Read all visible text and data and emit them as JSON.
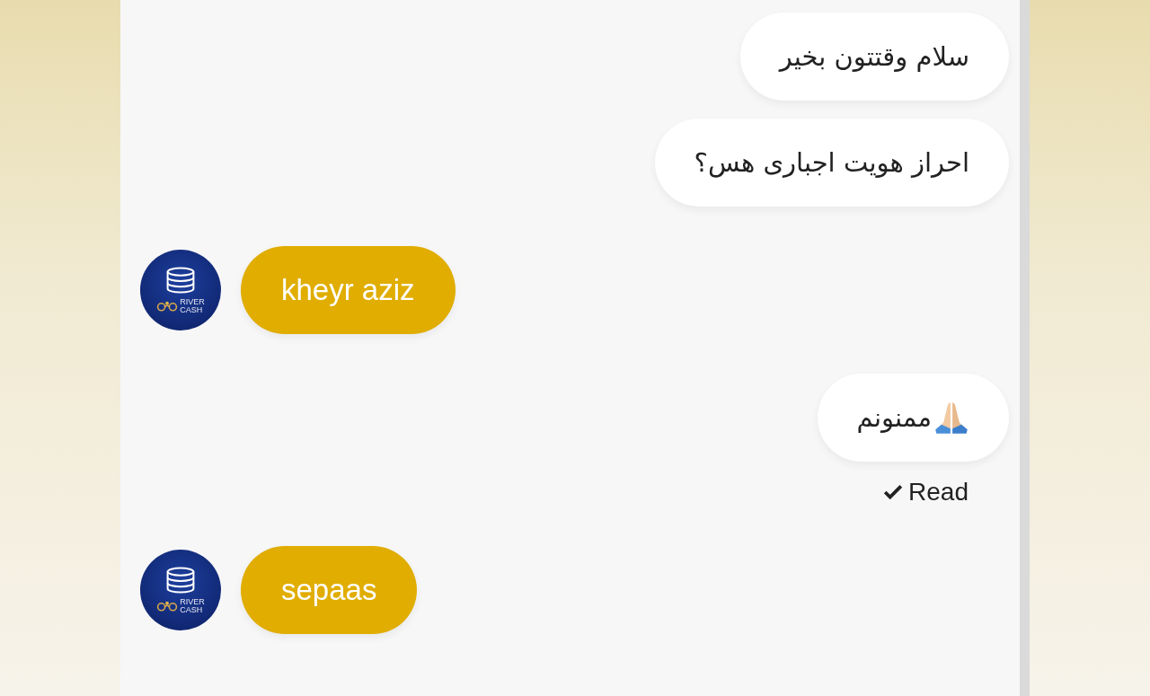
{
  "messages": [
    {
      "kind": "user",
      "text": "سلام وقتتون بخیر"
    },
    {
      "kind": "user",
      "text": "احراز هویت اجباری هس؟"
    },
    {
      "kind": "agent",
      "text": "kheyr aziz",
      "avatar": {
        "line_1": "RIVER",
        "line_2": "CASH"
      }
    },
    {
      "kind": "user",
      "text": "ممنونم",
      "has_emoji": true,
      "receipt": "Read"
    },
    {
      "kind": "agent",
      "text": "sepaas",
      "avatar": {
        "line_1": "RIVER",
        "line_2": "CASH"
      }
    }
  ]
}
